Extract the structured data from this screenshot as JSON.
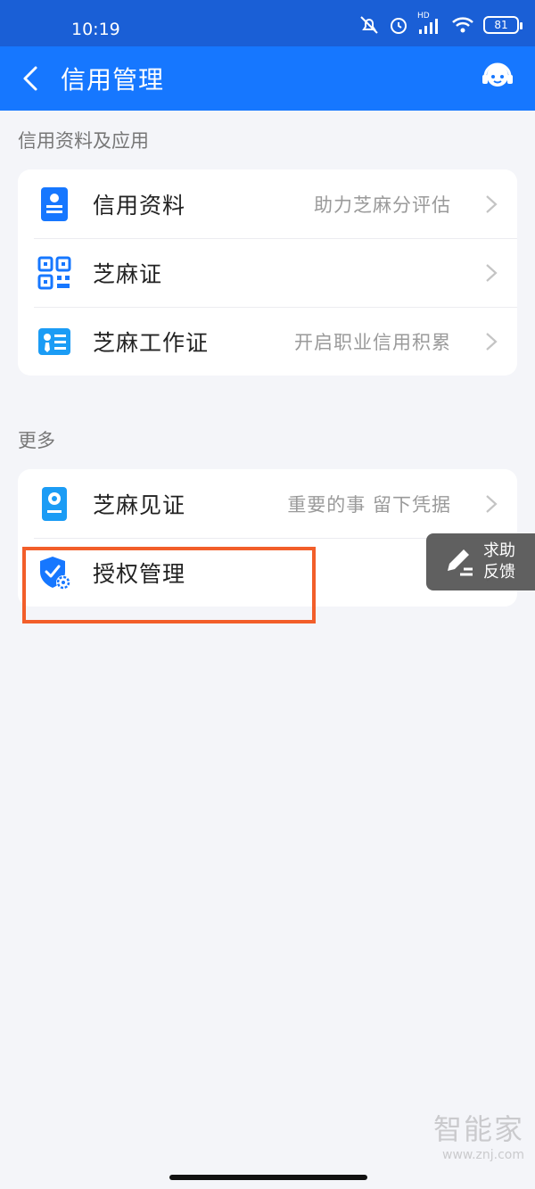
{
  "status": {
    "time": "10:19",
    "battery": "81",
    "network": "HD"
  },
  "nav": {
    "title": "信用管理"
  },
  "sections": {
    "credit": {
      "title": "信用资料及应用",
      "items": [
        {
          "label": "信用资料",
          "hint": "助力芝麻分评估",
          "icon": "id-card-icon"
        },
        {
          "label": "芝麻证",
          "hint": "",
          "icon": "qr-code-icon"
        },
        {
          "label": "芝麻工作证",
          "hint": "开启职业信用积累",
          "icon": "work-badge-icon"
        }
      ]
    },
    "more": {
      "title": "更多",
      "items": [
        {
          "label": "芝麻见证",
          "hint": "重要的事 留下凭据",
          "icon": "witness-icon"
        },
        {
          "label": "授权管理",
          "hint": "",
          "icon": "shield-gear-icon"
        }
      ]
    }
  },
  "help_float": {
    "line1": "求助",
    "line2": "反馈"
  },
  "watermark": {
    "main": "智能家",
    "sub": "www.znj.com"
  },
  "colors": {
    "primary": "#1677ff",
    "highlight": "#f25e2a"
  }
}
